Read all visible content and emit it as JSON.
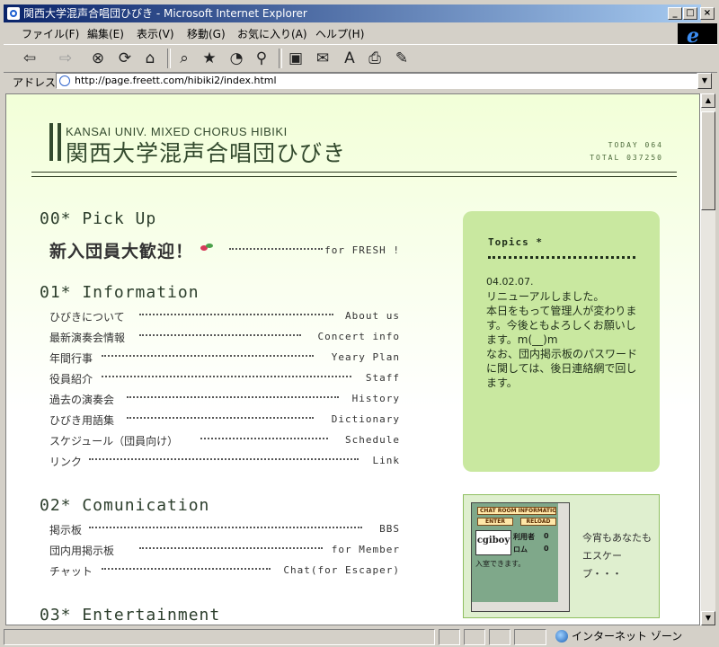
{
  "window": {
    "title": "関西大学混声合唱団ひびき - Microsoft Internet Explorer",
    "controls": {
      "minimize": "_",
      "maximize": "□",
      "close": "×"
    }
  },
  "menu": [
    "ファイル(F)",
    "編集(E)",
    "表示(V)",
    "移動(G)",
    "お気に入り(A)",
    "ヘルプ(H)"
  ],
  "address": {
    "label": "アドレス",
    "url": "http://page.freett.com/hibiki2/index.html"
  },
  "banner": {
    "subtitle": "KANSAI UNIV. MIXED CHORUS HIBIKI",
    "title": "関西大学混声合唱団ひびき",
    "today": "TODAY 064",
    "total": "TOTAL 037250"
  },
  "sections": {
    "pickup": {
      "heading": "00* Pick Up",
      "feature": "新入団員大歓迎！",
      "feature_link": "for FRESH !"
    },
    "information": {
      "heading": "01* Information",
      "items": [
        {
          "jp": "ひびきについて",
          "en": "About us"
        },
        {
          "jp": "最新演奏会情報",
          "en": "Concert info"
        },
        {
          "jp": "年間行事",
          "en": "Yeary Plan"
        },
        {
          "jp": "役員紹介",
          "en": "Staff"
        },
        {
          "jp": "過去の演奏会",
          "en": "History"
        },
        {
          "jp": "ひびき用語集",
          "en": "Dictionary"
        },
        {
          "jp": "スケジュール（団員向け）",
          "en": "Schedule"
        },
        {
          "jp": "リンク",
          "en": "Link"
        }
      ]
    },
    "communication": {
      "heading": "02* Comunication",
      "items": [
        {
          "jp": "掲示板",
          "en": "BBS"
        },
        {
          "jp": "団内用掲示板",
          "en": "for Member"
        },
        {
          "jp": "チャット",
          "en": "Chat(for Escaper)"
        }
      ]
    },
    "entertainment": {
      "heading": "03* Entertainment"
    }
  },
  "topics": {
    "heading": "Topics *",
    "date": "04.02.07.",
    "lines": [
      "リニューアルしました。",
      "本日をもって管理人が変わります。今後ともよろしくお願いします。m(__)m",
      "",
      "なお、団内掲示板のパスワードに関しては、後日連絡網で回します。"
    ]
  },
  "chat_widget": {
    "header": "CHAT ROOM INFORMATION",
    "enter": "ENTER",
    "reload": "RELOAD",
    "logo": "cgiboy",
    "users_label": "利用者",
    "users_value": "0",
    "rom_label": "ロム",
    "rom_value": "0",
    "status": "入室できます。",
    "side_text": "今宵もあなたもエスケープ・・・"
  },
  "statusbar": {
    "zone": "インターネット ゾーン"
  },
  "colors": {
    "accent": "#c9e8a0",
    "heading_text": "#2c3e2c",
    "title_gradient_start": "#0a246a"
  }
}
